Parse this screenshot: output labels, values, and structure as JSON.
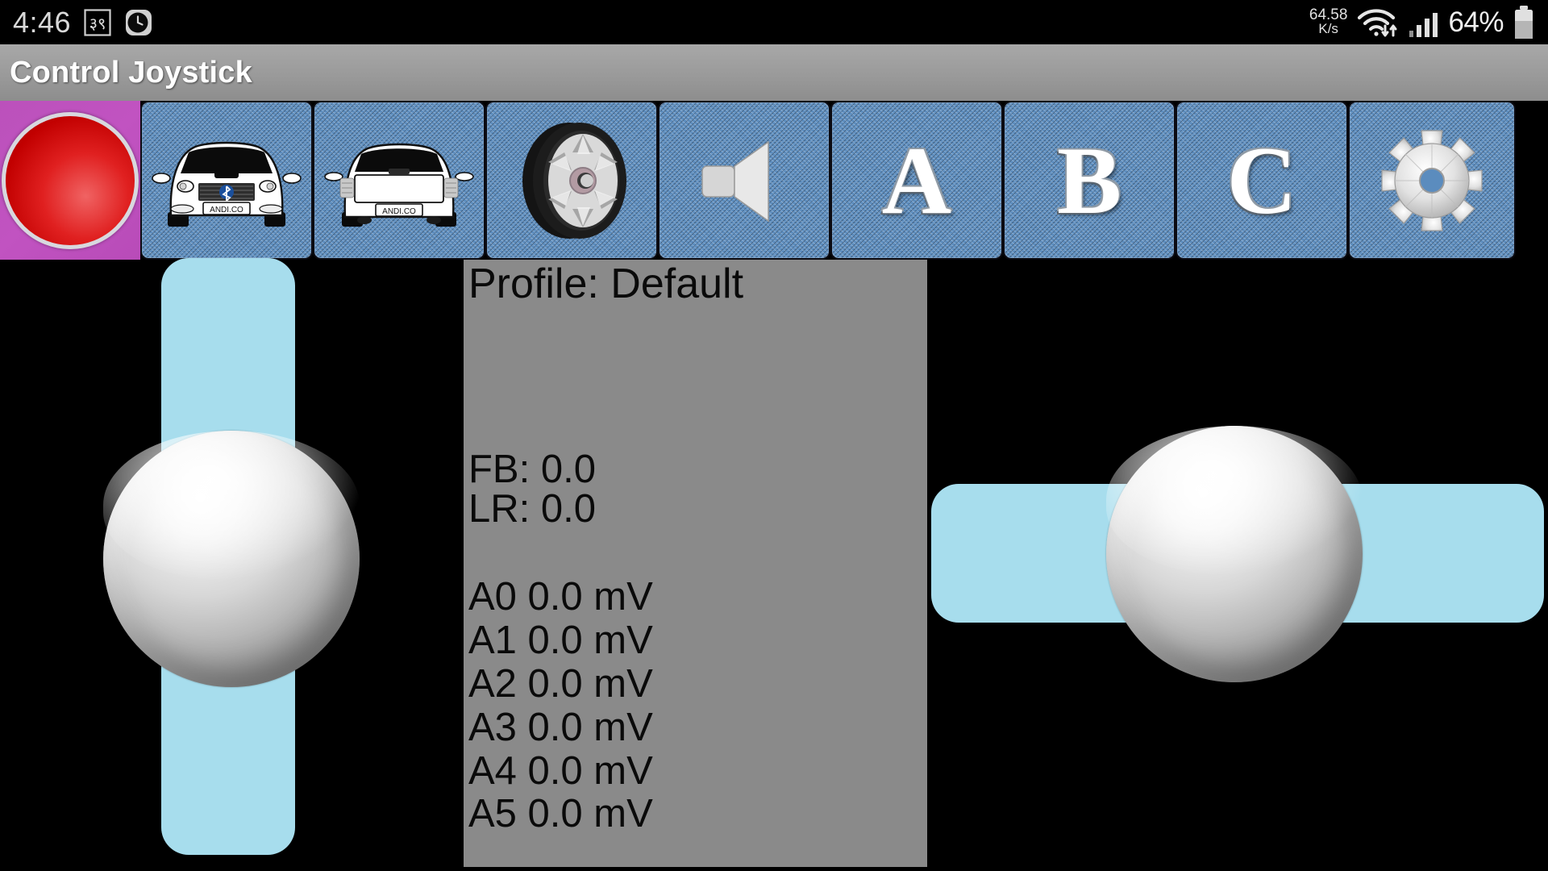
{
  "statusbar": {
    "clock": "4:46",
    "left_icons": [
      {
        "name": "devanagari-badge-icon",
        "glyph": "३९"
      },
      {
        "name": "clock-alarm-icon",
        "glyph": "◔"
      }
    ],
    "net_speed_value": "64.58",
    "net_speed_unit": "K/s",
    "wifi_icon": "wifi-icon",
    "signal_icon": "cellular-signal-icon",
    "battery_percent": "64%",
    "battery_icon": "battery-icon"
  },
  "titlebar": {
    "title": "Control Joystick"
  },
  "toolbar": {
    "buttons": [
      {
        "name": "connection-status-indicator",
        "type": "led",
        "label": "",
        "color": "#d00000",
        "bg": "#c153c1"
      },
      {
        "name": "car-front-button",
        "type": "icon",
        "label": "car-front-icon",
        "plate": "ANDI.CO"
      },
      {
        "name": "car-rear-button",
        "type": "icon",
        "label": "car-rear-icon",
        "plate": "ANDI.CO"
      },
      {
        "name": "wheel-button",
        "type": "icon",
        "label": "wheel-icon"
      },
      {
        "name": "speaker-button",
        "type": "icon",
        "label": "speaker-icon"
      },
      {
        "name": "button-a",
        "type": "letter",
        "label": "A"
      },
      {
        "name": "button-b",
        "type": "letter",
        "label": "B"
      },
      {
        "name": "button-c",
        "type": "letter",
        "label": "C"
      },
      {
        "name": "settings-button",
        "type": "icon",
        "label": "gear-icon"
      }
    ]
  },
  "panel": {
    "profile_label": "Profile: Default",
    "fb_label": "FB: 0.0",
    "lr_label": "LR: 0.0",
    "analog": [
      "A0 0.0 mV",
      "A1 0.0 mV",
      "A2 0.0 mV",
      "A3 0.0 mV",
      "A4 0.0 mV",
      "A5 0.0 mV"
    ]
  },
  "joysticks": {
    "left": {
      "name": "throttle-joystick",
      "axis": "vertical",
      "track_color": "#a7dded",
      "knob": "knob-ball"
    },
    "right": {
      "name": "steering-joystick",
      "axis": "horizontal",
      "track_color": "#a7dded",
      "knob": "knob-ball"
    }
  }
}
